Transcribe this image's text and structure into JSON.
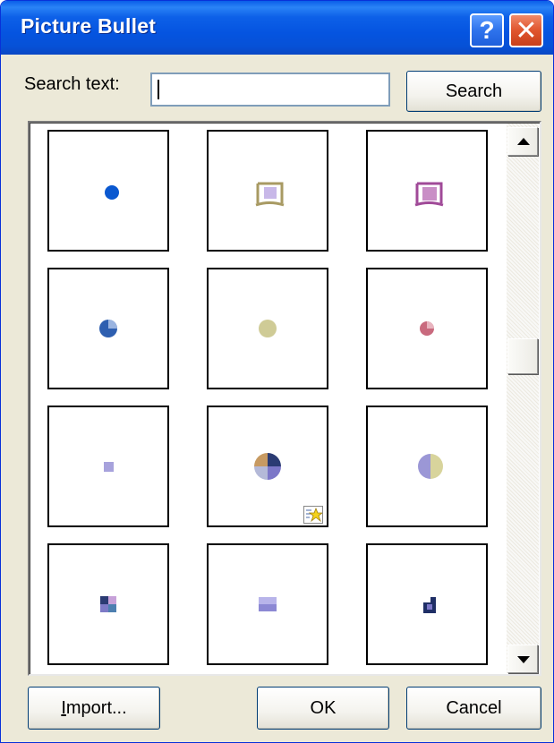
{
  "window": {
    "title": "Picture Bullet",
    "help_glyph": "?",
    "close_glyph": "✕"
  },
  "search": {
    "label": "Search text:",
    "value": "",
    "button_label": "Search"
  },
  "bullets": [
    {
      "shape": "dot",
      "colors": [
        "#0a58d0"
      ]
    },
    {
      "shape": "framed-square",
      "colors": [
        "#a89a63",
        "#c8b8e8"
      ]
    },
    {
      "shape": "framed-square",
      "colors": [
        "#a04a98",
        "#c98ec6"
      ]
    },
    {
      "shape": "pie",
      "colors": [
        "#2e5fb0",
        "#9ab4e0"
      ]
    },
    {
      "shape": "dot",
      "colors": [
        "#cfcb96"
      ]
    },
    {
      "shape": "pie",
      "colors": [
        "#c96a7e",
        "#e8b4bf"
      ]
    },
    {
      "shape": "square",
      "colors": [
        "#a7a2dc"
      ]
    },
    {
      "shape": "quad-circle",
      "colors": [
        "#c79a62",
        "#2b3b73",
        "#7c77c8",
        "#b4b9d8"
      ]
    },
    {
      "shape": "half-circle",
      "colors": [
        "#9b97d6",
        "#d8d49c"
      ]
    },
    {
      "shape": "quad-square",
      "colors": [
        "#2b3b73",
        "#c7a1d9",
        "#7d7ac6",
        "#4d7fb0"
      ]
    },
    {
      "shape": "split-square",
      "colors": [
        "#b8b4ea",
        "#8c88d4"
      ]
    },
    {
      "shape": "step-square",
      "colors": [
        "#1f2f66",
        "#7c77c8"
      ]
    }
  ],
  "buttons": {
    "import_first": "I",
    "import_rest": "mport...",
    "ok": "OK",
    "cancel": "Cancel"
  }
}
